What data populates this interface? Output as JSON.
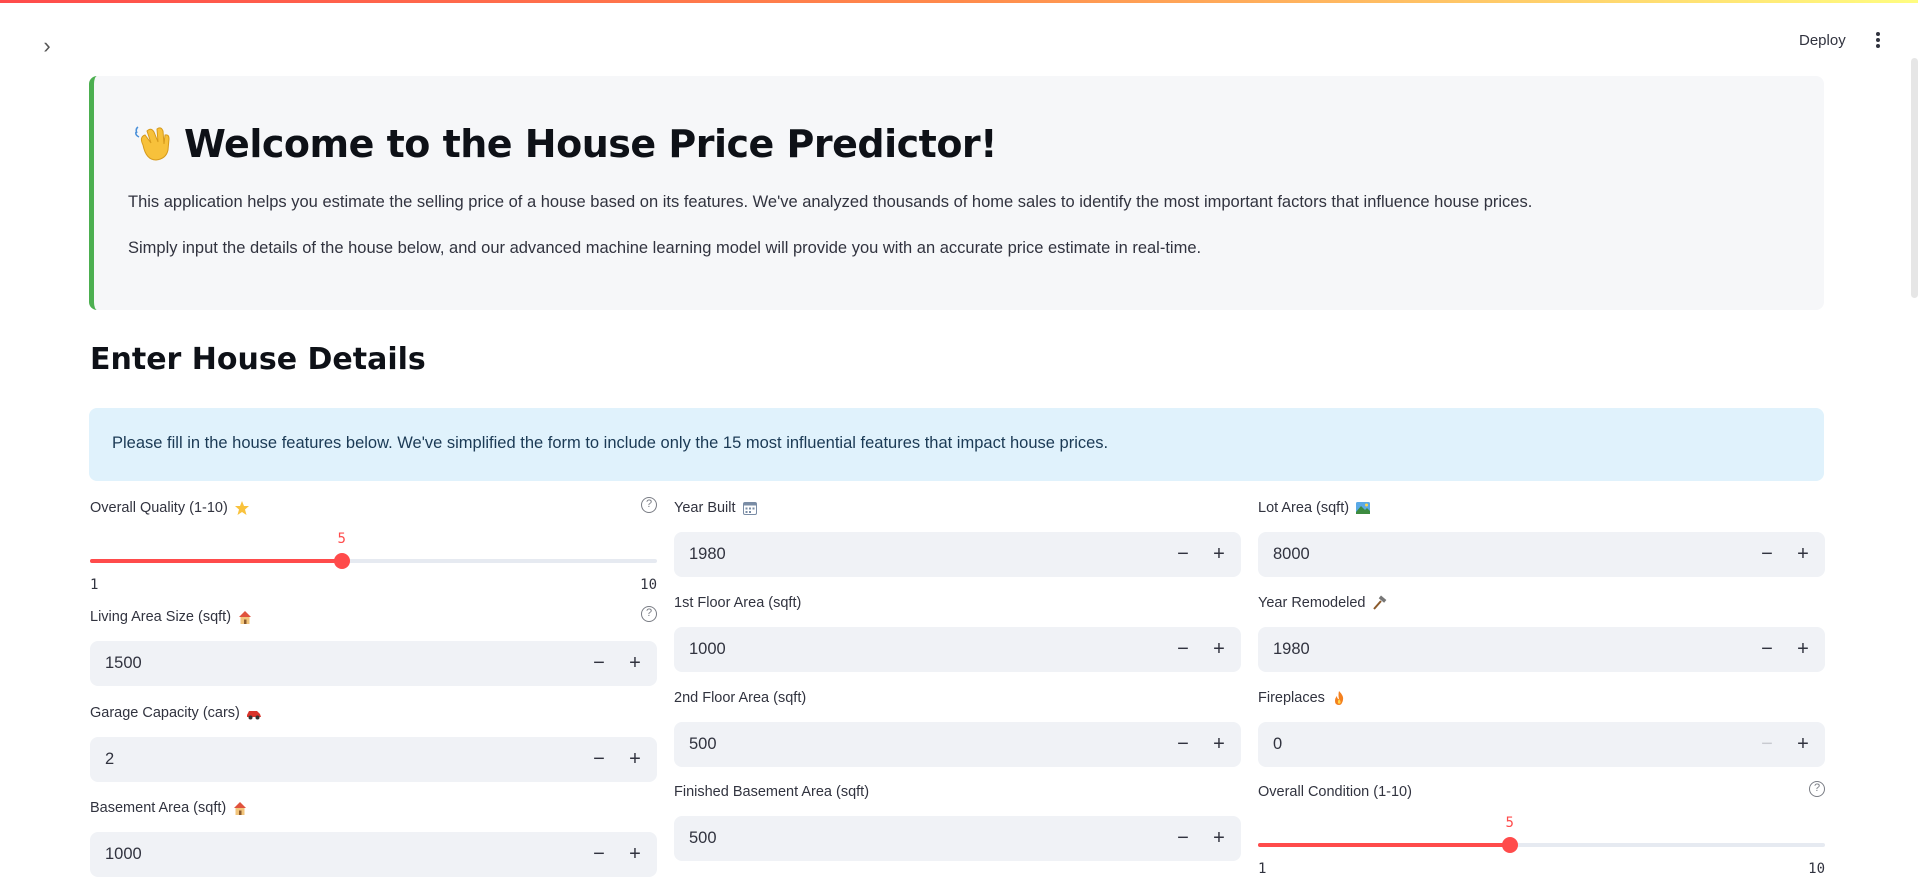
{
  "header": {
    "deploy_label": "Deploy"
  },
  "welcome": {
    "title": "Welcome to the House Price Predictor!",
    "paragraph1": "This application helps you estimate the selling price of a house based on its features. We've analyzed thousands of home sales to identify the most important factors that influence house prices.",
    "paragraph2": "Simply input the details of the house below, and our advanced machine learning model will provide you with an accurate price estimate in real-time."
  },
  "section_title": "Enter House Details",
  "info_text": "Please fill in the house features below. We've simplified the form to include only the 15 most influential features that impact house prices.",
  "fields": {
    "overall_quality": {
      "label": "Overall Quality (1-10)",
      "icon": "star-icon",
      "value": "5",
      "min": "1",
      "max": "10",
      "fraction": 0.444
    },
    "living_area": {
      "label": "Living Area Size (sqft)",
      "icon": "house-icon",
      "value": "1500"
    },
    "garage_capacity": {
      "label": "Garage Capacity (cars)",
      "icon": "car-icon",
      "value": "2"
    },
    "basement_area": {
      "label": "Basement Area (sqft)",
      "icon": "house-icon",
      "value": "1000"
    },
    "year_built": {
      "label": "Year Built",
      "icon": "calendar-icon",
      "value": "1980"
    },
    "first_floor_area": {
      "label": "1st Floor Area (sqft)",
      "value": "1000"
    },
    "second_floor_area": {
      "label": "2nd Floor Area (sqft)",
      "value": "500"
    },
    "finished_basement_area": {
      "label": "Finished Basement Area (sqft)",
      "value": "500"
    },
    "lot_area": {
      "label": "Lot Area (sqft)",
      "icon": "landscape-icon",
      "value": "8000"
    },
    "year_remodeled": {
      "label": "Year Remodeled",
      "icon": "hammer-icon",
      "value": "1980"
    },
    "fireplaces": {
      "label": "Fireplaces",
      "icon": "fire-icon",
      "value": "0"
    },
    "overall_condition": {
      "label": "Overall Condition (1-10)",
      "value": "5",
      "min": "1",
      "max": "10",
      "fraction": 0.444
    }
  },
  "colors": {
    "accent": "#ff4b4b",
    "welcome_border": "#4caf50",
    "info_bg": "#e0f2fc"
  }
}
